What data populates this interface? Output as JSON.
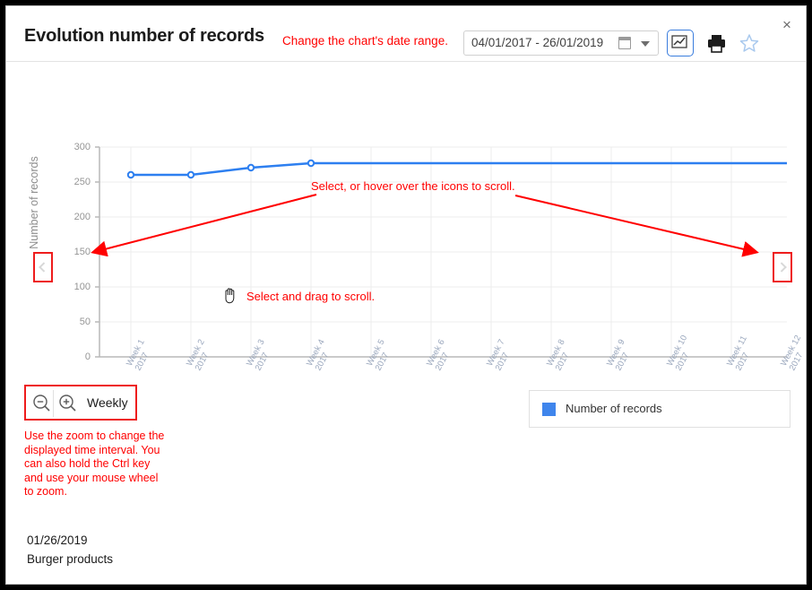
{
  "window": {
    "close_label": "×"
  },
  "header": {
    "title": "Evolution number of records",
    "date_hint": "Change the chart's date range.",
    "date_range_value": "04/01/2017 - 26/01/2019",
    "icons": {
      "calendar": "calendar-icon",
      "caret": "chevron-down-icon",
      "chart_view": "chart-line-icon",
      "print": "printer-icon",
      "favorite": "star-icon"
    }
  },
  "annotations": {
    "scroll": "Select, or hover over the icons to scroll.",
    "drag": "Select and drag to scroll.",
    "hand_cursor": "✋",
    "zoom_instructions": "Use the zoom to change the displayed time interval. You can also hold the Ctrl key and use your mouse wheel to zoom.",
    "color": "#ff0000"
  },
  "controls": {
    "scroll_left": "‹",
    "scroll_right": "›",
    "zoom_out": "zoom-out-icon",
    "zoom_in": "zoom-in-icon",
    "interval_label": "Weekly"
  },
  "legend": {
    "label": "Number of records",
    "color": "#3f85ec"
  },
  "footer": {
    "date": "01/26/2019",
    "subject": "Burger products"
  },
  "chart_data": {
    "type": "line",
    "title": "Evolution number of records",
    "xlabel": "",
    "ylabel": "Number of records",
    "ylim": [
      0,
      300
    ],
    "yticks": [
      0,
      50,
      100,
      150,
      200,
      250,
      300
    ],
    "grid": true,
    "legend_position": "bottom-right",
    "line_color": "#2d7ff0",
    "marker": "circle",
    "categories": [
      "Week 1\n2017",
      "Week 2\n2017",
      "Week 3\n2017",
      "Week 4\n2017",
      "Week 5\n2017",
      "Week 6\n2017",
      "Week 7\n2017",
      "Week 8\n2017",
      "Week 9\n2017",
      "Week 10\n2017",
      "Week 11\n2017",
      "Week 12\n2017"
    ],
    "series": [
      {
        "name": "Number of records",
        "values": [
          260,
          260,
          270,
          277,
          277,
          277,
          277,
          277,
          277,
          277,
          277,
          277
        ]
      }
    ]
  }
}
